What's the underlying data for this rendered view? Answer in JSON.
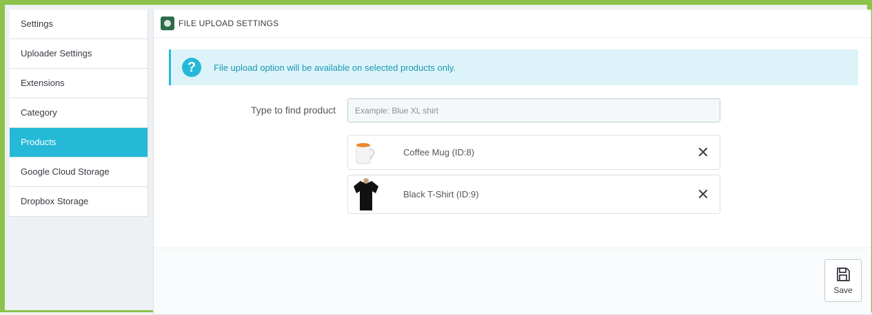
{
  "sidebar": {
    "items": [
      {
        "label": "Settings",
        "active": false
      },
      {
        "label": "Uploader Settings",
        "active": false
      },
      {
        "label": "Extensions",
        "active": false
      },
      {
        "label": "Category",
        "active": false
      },
      {
        "label": "Products",
        "active": true
      },
      {
        "label": "Google Cloud Storage",
        "active": false
      },
      {
        "label": "Dropbox Storage",
        "active": false
      }
    ]
  },
  "panel": {
    "title": "FILE UPLOAD SETTINGS",
    "alert": "File upload option will be available on selected products only.",
    "search_label": "Type to find product",
    "search_placeholder": "Example: Blue XL shirt",
    "products": [
      {
        "name": "Coffee Mug (ID:8)",
        "icon": "mug-icon"
      },
      {
        "name": "Black T-Shirt (ID:9)",
        "icon": "tshirt-icon"
      }
    ],
    "save_label": "Save"
  },
  "colors": {
    "accent": "#25b9d7",
    "frame": "#8bc34a",
    "alert_bg": "#dcf4f9"
  }
}
